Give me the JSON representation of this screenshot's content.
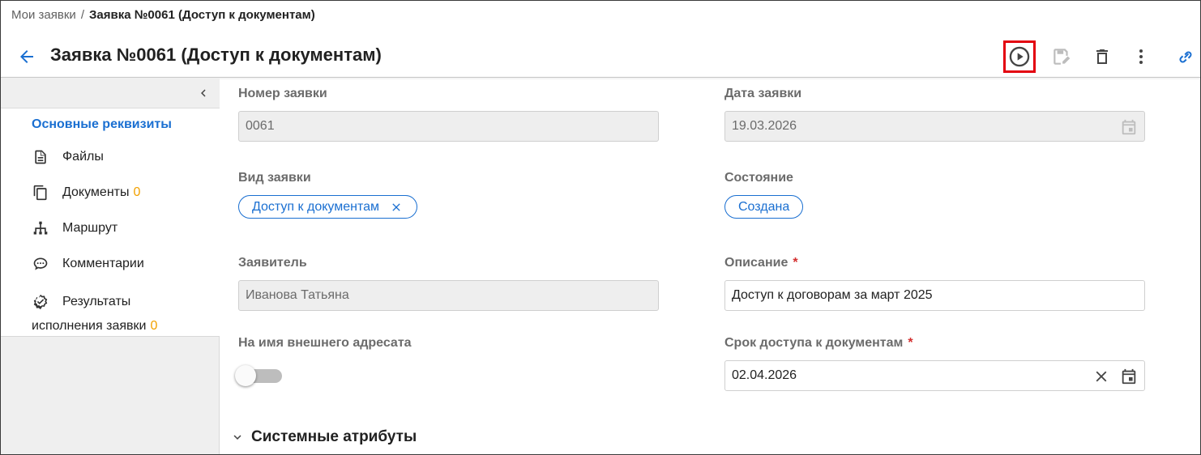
{
  "breadcrumb": {
    "parent": "Мои заявки",
    "separator": "/",
    "current": "Заявка №0061 (Доступ к документам)"
  },
  "header": {
    "title": "Заявка №0061 (Доступ к документам)",
    "actions": [
      {
        "icon": "play-circle-icon",
        "highlighted": true
      },
      {
        "icon": "save-edit-icon",
        "disabled": true
      },
      {
        "icon": "trash-icon"
      },
      {
        "icon": "more-vertical-icon"
      },
      {
        "icon": "link-icon"
      }
    ]
  },
  "sidebar": {
    "active_item": "Основные реквизиты",
    "items": [
      {
        "label": "Файлы",
        "icon": "file-icon"
      },
      {
        "label": "Документы",
        "count": "0",
        "icon": "documents-icon"
      },
      {
        "label": "Маршрут",
        "icon": "route-icon"
      },
      {
        "label": "Комментарии",
        "icon": "comment-icon"
      },
      {
        "label_line1": "Результаты",
        "label_line2": "исполнения заявки",
        "count": "0",
        "icon": "verified-icon"
      }
    ]
  },
  "form": {
    "number": {
      "label": "Номер заявки",
      "value": "0061"
    },
    "date": {
      "label": "Дата заявки",
      "value": "19.03.2026"
    },
    "type": {
      "label": "Вид заявки",
      "value": "Доступ к документам"
    },
    "state": {
      "label": "Состояние",
      "value": "Создана"
    },
    "applicant": {
      "label": "Заявитель",
      "value": "Иванова Татьяна"
    },
    "description": {
      "label": "Описание",
      "required_mark": "*",
      "value": "Доступ к договорам за март 2025"
    },
    "external": {
      "label": "На имя внешнего адресата",
      "checked": false
    },
    "access_term": {
      "label": "Срок доступа к документам",
      "required_mark": "*",
      "value": "02.04.2026"
    }
  },
  "section": {
    "title": "Системные атрибуты"
  },
  "colors": {
    "accent": "#1a6fd1",
    "highlight_border": "#e3000f",
    "count": "#f2a100",
    "required": "#d32f2f"
  }
}
